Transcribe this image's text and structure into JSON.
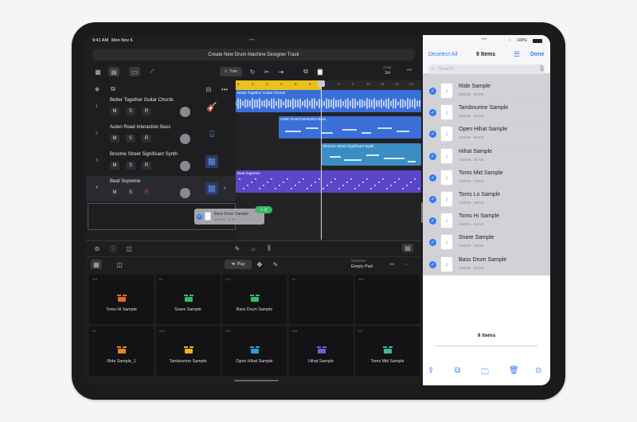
{
  "status_bar": {
    "time": "9:41 AM",
    "date": "Mon Nov 6",
    "battery": "100%"
  },
  "top_bar": {
    "title": "Create New Drum Machine Designer Track"
  },
  "toolbar": {
    "trim_label": "Trim",
    "snap_label": "Snap",
    "snap_value": "1/4"
  },
  "ruler": {
    "bars": [
      "1",
      "2",
      "3",
      "4",
      "5",
      "6",
      "7",
      "8",
      "9",
      "10",
      "11",
      "12",
      "13"
    ]
  },
  "tracks": [
    {
      "number": "1",
      "name": "Better Together Guitar Chords",
      "region_label": "Better Together Guitar Chords",
      "color": "#3b6fd8",
      "icon": "guitar-icon"
    },
    {
      "number": "2",
      "name": "Auten Road Interaction Bass",
      "region_label": "Auten Road Interaction Bass",
      "color": "#3b6fd8",
      "icon": "keyboard-icon"
    },
    {
      "number": "3",
      "name": "Broome Street Significant Synth",
      "region_label": "Broome Street Significant Synth",
      "color": "#3a8ec4",
      "icon": "synth-icon"
    },
    {
      "number": "4",
      "name": "Beat Supreme",
      "region_label": "Beat Supreme",
      "color": "#5b46c6",
      "icon": "drum-machine-icon"
    }
  ],
  "track_buttons": {
    "mute": "M",
    "solo": "S",
    "record": "R"
  },
  "drag_item": {
    "name": "Bass Drum Sample",
    "meta": "1/16/18 · 24 KB",
    "count": "9"
  },
  "bottom_toolbar": {
    "play_label": "Play",
    "selection_label": "Selection",
    "selection_value": "Empty Pad"
  },
  "pads": [
    {
      "id": "F#1",
      "label": "Toms Hi Sample",
      "color": "#e86a2b"
    },
    {
      "id": "D1",
      "label": "Snare Sample",
      "color": "#3db86a"
    },
    {
      "id": "C#1",
      "label": "Bass Drum Sample",
      "color": "#3db86a"
    },
    {
      "id": "A1",
      "label": "",
      "color": ""
    },
    {
      "id": "A#1",
      "label": "",
      "color": ""
    },
    {
      "id": "E1",
      "label": "Ride Sample_1",
      "color": "#e8832b"
    },
    {
      "id": "C#2",
      "label": "Tambourine Sample",
      "color": "#e8b62b"
    },
    {
      "id": "F#1",
      "label": "Open Hihat Sample",
      "color": "#2b9fd8"
    },
    {
      "id": "D#1",
      "label": "Hihat Sample",
      "color": "#7a5ad8"
    },
    {
      "id": "G1",
      "label": "Toms Mid Sample",
      "color": "#3db8a0"
    }
  ],
  "files_panel": {
    "deselect_label": "Deselect All",
    "title": "9 Items",
    "done_label": "Done",
    "search_placeholder": "Search",
    "items": [
      {
        "name": "Ride Sample",
        "meta": "2/26/18 · 83 KB"
      },
      {
        "name": "Tambourine Sample",
        "meta": "2/16/18 · 36 KB"
      },
      {
        "name": "Open Hihat Sample",
        "meta": "2/16/18 · 55 KB"
      },
      {
        "name": "Hihat Sample",
        "meta": "2/16/18 · 25 KB"
      },
      {
        "name": "Toms Mid Sample",
        "meta": "1/16/18 · 43 KB"
      },
      {
        "name": "Toms Lo Sample",
        "meta": "1/16/18 · 48 KB"
      },
      {
        "name": "Toms Hi Sample",
        "meta": "1/16/18 · 44 KB"
      },
      {
        "name": "Snare Sample",
        "meta": "1/16/18 · 26 KB"
      },
      {
        "name": "Bass Drum Sample",
        "meta": "1/16/18 · 24 KB"
      }
    ],
    "footer_count": "9 items"
  },
  "colors": {
    "accent_blue": "#2f7af5",
    "ruler_yellow": "#e8c21b",
    "track_selected": "#2a2a2e"
  }
}
